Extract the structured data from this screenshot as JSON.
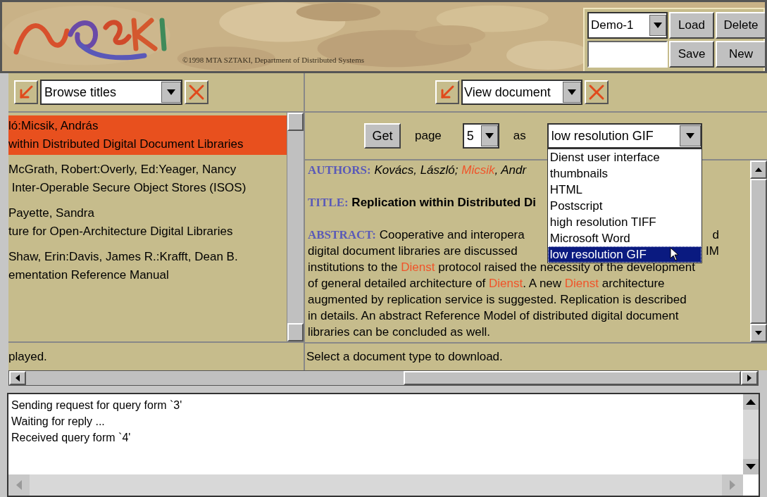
{
  "header": {
    "copyright": "©1998 MTA SZTAKI, Department of Distributed Systems",
    "profile": {
      "select": "Demo-1",
      "buttons": [
        "Load",
        "Delete",
        "Save",
        "New"
      ]
    }
  },
  "left_panel": {
    "view_select": "Browse titles",
    "items": [
      {
        "lines": [
          "ló:Micsik, András",
          "within Distributed Digital Document Libraries"
        ],
        "selected": true
      },
      {
        "lines": [
          "McGrath, Robert:Overly, Ed:Yeager, Nancy",
          " Inter-Operable Secure Object Stores (ISOS)"
        ],
        "selected": false
      },
      {
        "lines": [
          "Payette, Sandra",
          "ture for Open-Architecture Digital Libraries"
        ],
        "selected": false
      },
      {
        "lines": [
          "Shaw, Erin:Davis, James R.:Krafft, Dean B.",
          "ementation Reference Manual"
        ],
        "selected": false
      }
    ],
    "status": "played."
  },
  "right_panel": {
    "view_select": "View document",
    "get_button": "Get",
    "page_label": "page",
    "page_select": "5",
    "as_label": "as",
    "format_select": "low resolution GIF",
    "format_options": [
      {
        "label": "Dienst user interface",
        "selected": false
      },
      {
        "label": "thumbnails",
        "selected": false
      },
      {
        "label": "HTML",
        "selected": false
      },
      {
        "label": "Postscript",
        "selected": false
      },
      {
        "label": "high resolution TIFF",
        "selected": false
      },
      {
        "label": "Microsoft Word",
        "selected": false
      },
      {
        "label": "low resolution GIF",
        "selected": true
      }
    ],
    "document": {
      "paragraphs": [
        {
          "lines": [
            {
              "segments": [
                {
                  "kind": "label",
                  "text": "AUTHORS:"
                },
                {
                  "kind": "italic",
                  "text": " Kovács, László; "
                },
                {
                  "kind": "italic-highlight",
                  "text": "Micsik"
                },
                {
                  "kind": "italic",
                  "text": ", Andr"
                }
              ]
            }
          ]
        },
        {
          "lines": [
            {
              "segments": [
                {
                  "kind": "label",
                  "text": "TITLE:"
                },
                {
                  "kind": "bold",
                  "text": " Replication within Distributed Di"
                }
              ]
            }
          ]
        },
        {
          "lines": [
            {
              "segments": [
                {
                  "kind": "label",
                  "text": "ABSTRACT:"
                },
                {
                  "kind": "text",
                  "text": " Cooperative and interopera"
                }
              ],
              "right": "d"
            },
            {
              "segments": [
                {
                  "kind": "text",
                  "text": "digital document libraries are discussed"
                }
              ],
              "right": "IM"
            },
            {
              "segments": [
                {
                  "kind": "text",
                  "text": "institutions to the "
                },
                {
                  "kind": "highlight",
                  "text": "Dienst"
                },
                {
                  "kind": "text",
                  "text": " protocol raised the necessity of the development"
                }
              ]
            },
            {
              "segments": [
                {
                  "kind": "text",
                  "text": "of general detailed architecture of "
                },
                {
                  "kind": "highlight",
                  "text": "Dienst"
                },
                {
                  "kind": "text",
                  "text": ". A new "
                },
                {
                  "kind": "highlight",
                  "text": "Dienst"
                },
                {
                  "kind": "text",
                  "text": " architecture"
                }
              ]
            },
            {
              "segments": [
                {
                  "kind": "text",
                  "text": "augmented by replication service is suggested. Replication is described"
                }
              ]
            },
            {
              "segments": [
                {
                  "kind": "text",
                  "text": "in details. An abstract Reference Model of distributed digital document"
                }
              ]
            },
            {
              "segments": [
                {
                  "kind": "text",
                  "text": "libraries can be concluded as well."
                }
              ]
            }
          ]
        }
      ]
    },
    "status": "Select a document type to download."
  },
  "log": {
    "lines": [
      "Sending request for query form `3'",
      "Waiting for reply ...",
      "Received query form `4'"
    ]
  }
}
